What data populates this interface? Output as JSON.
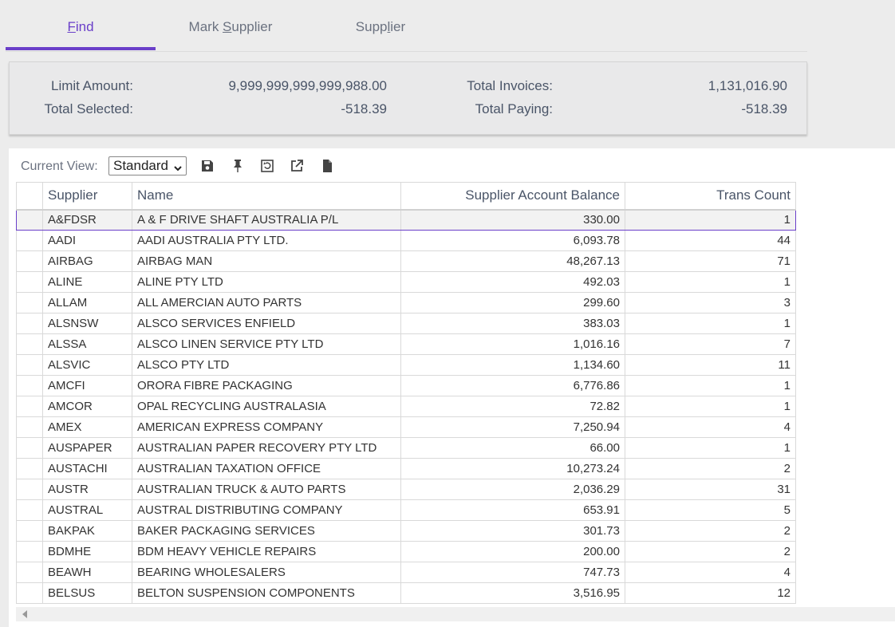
{
  "tabs": [
    {
      "label_pre": "",
      "label_u": "F",
      "label_post": "ind",
      "active": true
    },
    {
      "label_pre": "Mark ",
      "label_u": "S",
      "label_post": "upplier",
      "active": false
    },
    {
      "label_pre": "Supp",
      "label_u": "l",
      "label_post": "ier",
      "active": false
    }
  ],
  "summary": {
    "limit_amount_label": "Limit Amount:",
    "limit_amount_value": "9,999,999,999,999,988.00",
    "total_selected_label": "Total Selected:",
    "total_selected_value": "-518.39",
    "total_invoices_label": "Total Invoices:",
    "total_invoices_value": "1,131,016.90",
    "total_paying_label": "Total Paying:",
    "total_paying_value": "-518.39"
  },
  "toolbar": {
    "current_view_label": "Current View:",
    "current_view_value": "Standard",
    "icons": [
      "save-icon",
      "pin-icon",
      "restore-layout-icon",
      "export-icon",
      "document-icon"
    ]
  },
  "grid": {
    "columns": [
      "Supplier",
      "Name",
      "Supplier Account Balance",
      "Trans Count"
    ],
    "rows": [
      [
        "A&FDSR",
        "A & F DRIVE SHAFT AUSTRALIA P/L",
        "330.00",
        "1"
      ],
      [
        "AADI",
        "AADI  AUSTRALIA  PTY LTD.",
        "6,093.78",
        "44"
      ],
      [
        "AIRBAG",
        "AIRBAG MAN",
        "48,267.13",
        "71"
      ],
      [
        "ALINE",
        "ALINE PTY LTD",
        "492.03",
        "1"
      ],
      [
        "ALLAM",
        "ALL AMERCIAN AUTO PARTS",
        "299.60",
        "3"
      ],
      [
        "ALSNSW",
        "ALSCO SERVICES ENFIELD",
        "383.03",
        "1"
      ],
      [
        "ALSSA",
        "ALSCO LINEN SERVICE PTY LTD",
        "1,016.16",
        "7"
      ],
      [
        "ALSVIC",
        "ALSCO PTY LTD",
        "1,134.60",
        "11"
      ],
      [
        "AMCFI",
        "ORORA FIBRE PACKAGING",
        "6,776.86",
        "1"
      ],
      [
        "AMCOR",
        "OPAL RECYCLING AUSTRALASIA",
        "72.82",
        "1"
      ],
      [
        "AMEX",
        "AMERICAN EXPRESS COMPANY",
        "7,250.94",
        "4"
      ],
      [
        "AUSPAPER",
        "AUSTRALIAN PAPER RECOVERY PTY LTD",
        "66.00",
        "1"
      ],
      [
        "AUSTACHI",
        "AUSTRALIAN TAXATION OFFICE",
        "10,273.24",
        "2"
      ],
      [
        "AUSTR",
        "AUSTRALIAN TRUCK & AUTO PARTS",
        "2,036.29",
        "31"
      ],
      [
        "AUSTRAL",
        "AUSTRAL DISTRIBUTING COMPANY",
        "653.91",
        "5"
      ],
      [
        "BAKPAK",
        "BAKER PACKAGING SERVICES",
        "301.73",
        "2"
      ],
      [
        "BDMHE",
        "BDM HEAVY VEHICLE REPAIRS",
        "200.00",
        "2"
      ],
      [
        "BEAWH",
        "BEARING  WHOLESALERS",
        "747.73",
        "4"
      ],
      [
        "BELSUS",
        "BELTON SUSPENSION COMPONENTS",
        "3,516.95",
        "12"
      ]
    ]
  },
  "colors": {
    "accent": "#6a3fc9",
    "text": "#4a5568"
  }
}
